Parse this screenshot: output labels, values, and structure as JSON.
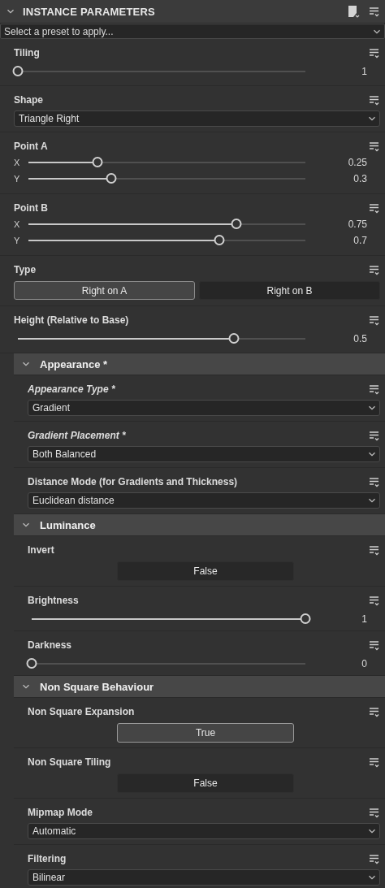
{
  "panel": {
    "title": "INSTANCE PARAMETERS",
    "expanded": true,
    "preset": {
      "placeholder": "Select a preset to apply..."
    }
  },
  "items": [
    {
      "kind": "slider",
      "label": "Tiling",
      "rows": [
        {
          "level": 0,
          "value": "1"
        }
      ]
    },
    {
      "kind": "dropdown",
      "label": "Shape",
      "value": "Triangle Right"
    },
    {
      "kind": "slider",
      "label": "Point A",
      "rows": [
        {
          "axis": "X",
          "level": 0.25,
          "value": "0.25"
        },
        {
          "axis": "Y",
          "level": 0.3,
          "value": "0.3"
        }
      ]
    },
    {
      "kind": "slider",
      "label": "Point B",
      "rows": [
        {
          "axis": "X",
          "level": 0.75,
          "value": "0.75"
        },
        {
          "axis": "Y",
          "level": 0.69,
          "value": "0.7"
        }
      ]
    },
    {
      "kind": "segmented",
      "label": "Type",
      "options": [
        {
          "label": "Right on A",
          "selected": true
        },
        {
          "label": "Right on B",
          "selected": false
        }
      ]
    },
    {
      "kind": "slider",
      "label": "Height (Relative to Base)",
      "rows": [
        {
          "level": 0.75,
          "value": "0.5"
        }
      ]
    },
    {
      "kind": "group",
      "label": "Appearance *",
      "expanded": true,
      "children": [
        {
          "kind": "dropdown",
          "label": "Appearance Type *",
          "italic": true,
          "value": "Gradient"
        },
        {
          "kind": "dropdown",
          "label": "Gradient Placement *",
          "italic": true,
          "value": "Both Balanced"
        },
        {
          "kind": "dropdown",
          "label": "Distance Mode (for Gradients and Thickness)",
          "value": "Euclidean distance"
        }
      ]
    },
    {
      "kind": "group",
      "label": "Luminance",
      "expanded": true,
      "children": [
        {
          "kind": "toggle",
          "label": "Invert",
          "on": false,
          "value": "False"
        },
        {
          "kind": "slider",
          "label": "Brightness",
          "rows": [
            {
              "level": 1,
              "value": "1"
            }
          ]
        },
        {
          "kind": "slider",
          "label": "Darkness",
          "rows": [
            {
              "level": 0,
              "value": "0"
            }
          ]
        }
      ]
    },
    {
      "kind": "group",
      "label": "Non Square Behaviour",
      "expanded": true,
      "children": [
        {
          "kind": "toggle",
          "label": "Non Square Expansion",
          "on": true,
          "value": "True"
        },
        {
          "kind": "toggle",
          "label": "Non Square Tiling",
          "on": false,
          "value": "False"
        },
        {
          "kind": "dropdown",
          "label": "Mipmap Mode",
          "value": "Automatic"
        },
        {
          "kind": "dropdown",
          "label": "Filtering",
          "value": "Bilinear"
        }
      ]
    }
  ]
}
